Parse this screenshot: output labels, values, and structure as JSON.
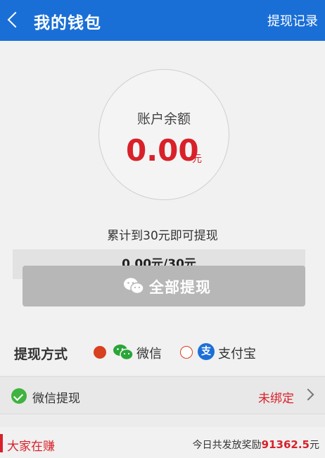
{
  "header": {
    "title": "我的钱包",
    "record_link": "提现记录"
  },
  "balance": {
    "label": "账户余额",
    "amount": "0.00",
    "unit": "元"
  },
  "threshold_hint": "累计到30元即可提现",
  "progress": {
    "text": "0.00元/30元",
    "fraction": 0.0
  },
  "withdraw_button": {
    "label": "全部提现"
  },
  "methods": {
    "label": "提现方式",
    "options": [
      {
        "name": "微信",
        "selected": true
      },
      {
        "name": "支付宝",
        "selected": false
      }
    ]
  },
  "wechat_row": {
    "label": "微信提现",
    "status": "未绑定"
  },
  "footer": {
    "title": "大家在赚",
    "reward_prefix": "今日共发放奖励",
    "reward_amount": "91362.5",
    "reward_unit": "元"
  },
  "colors": {
    "header_blue": "#1a6fd6",
    "accent_red": "#d8212a",
    "wechat_green": "#3eb33f",
    "alipay_blue": "#1d6fd6"
  }
}
